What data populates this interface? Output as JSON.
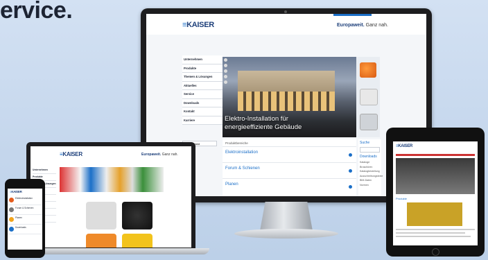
{
  "tagline": "ervice.",
  "brand": {
    "mark": "≡",
    "name": "KAISER",
    "claim_bold": "Europaweit.",
    "claim_rest": " Ganz nah."
  },
  "desktop": {
    "nav": [
      "Unternehmen",
      "Produkte",
      "Themen & Lösungen",
      "Aktuelles",
      "Service",
      "Downloads",
      "Kontakt",
      "Karriere"
    ],
    "hero_caption_line1": "Elektro-Installation für",
    "hero_caption_line2": "energieeffiziente Gebäude",
    "language_select": "Deutschland",
    "product_heading": "Produktbereiche",
    "categories": [
      "Elektroinstallation",
      "Forum & Schienen",
      "Planen"
    ],
    "right_heading": "Suche",
    "right_sub": "Downloads",
    "right_links": [
      "Kataloge",
      "Broschüren",
      "Katalogbestellung",
      "Ausschreibungstexte",
      "BIM-Daten",
      "Normen"
    ]
  },
  "laptop": {
    "nav": [
      "Unternehmen",
      "Produkte",
      "Themen & Lösungen",
      "Aktuelles",
      "Service",
      "Downloads",
      "Kontakt",
      "Karriere"
    ]
  },
  "tablet": {
    "heading": "Produkte"
  },
  "phone": {
    "items": [
      "Elektroinstallation",
      "Forum & Schienen",
      "Planen",
      "Downloads"
    ]
  },
  "colors": {
    "brand_blue": "#1b6fc8",
    "brand_dark": "#1d3f7a"
  }
}
